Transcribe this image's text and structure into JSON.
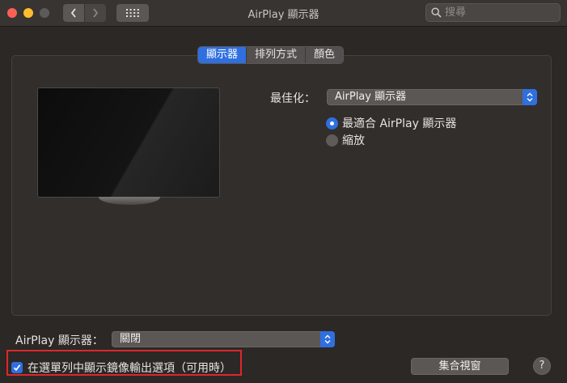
{
  "window": {
    "title": "AirPlay 顯示器"
  },
  "toolbar": {
    "back_icon": "chevron-left-icon",
    "forward_icon": "chevron-right-icon",
    "grid_icon": "grid-icon"
  },
  "search": {
    "placeholder": "搜尋",
    "value": ""
  },
  "tabs": [
    {
      "label": "顯示器",
      "active": true
    },
    {
      "label": "排列方式",
      "active": false
    },
    {
      "label": "顏色",
      "active": false
    }
  ],
  "display": {
    "optimize_label": "最佳化：",
    "optimize_value": "AirPlay 顯示器",
    "radio_options": [
      {
        "label": "最適合 AirPlay 顯示器",
        "selected": true
      },
      {
        "label": "縮放",
        "selected": false
      }
    ]
  },
  "airplay": {
    "label": "AirPlay 顯示器：",
    "value": "關閉"
  },
  "mirroring": {
    "label": "在選單列中顯示鏡像輸出選項（可用時）",
    "checked": true
  },
  "buttons": {
    "gather": "集合視窗",
    "help": "?"
  },
  "colors": {
    "accent": "#2f6fe0",
    "highlight_box": "#e0262c"
  }
}
